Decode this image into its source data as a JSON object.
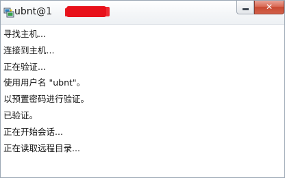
{
  "window": {
    "title": "ubnt@1",
    "close_glyph": "✕",
    "icons": {
      "app": "putty-app-icon",
      "minimize": "minimize-icon",
      "close": "close-icon"
    },
    "colors": {
      "redaction": "#e8101a",
      "close_button": "#c94a32"
    }
  },
  "log": [
    "寻找主机...",
    "连接到主机...",
    "正在验证...",
    "使用用户名 \"ubnt\"。",
    "以预置密码进行验证。",
    "已验证。",
    "正在开始会话...",
    "正在读取远程目录..."
  ]
}
